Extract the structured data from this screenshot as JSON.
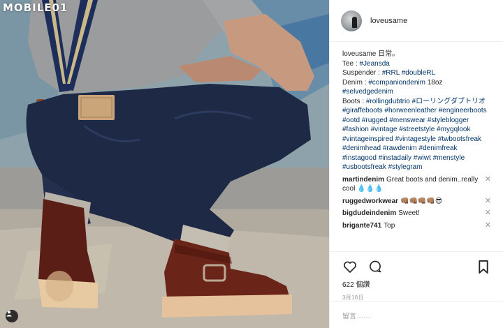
{
  "photo": {
    "watermark": "MOBILE01",
    "media_badge_icon": "person-tag-icon"
  },
  "header": {
    "username": "loveusame"
  },
  "caption": {
    "username": "loveusame",
    "lines": [
      {
        "text": "日常。",
        "tags": []
      },
      {
        "text": "Tee : ",
        "tags": [
          "#Jeansda"
        ]
      },
      {
        "text": "Suspender : ",
        "tags": [
          "#RRL",
          "#doubleRL"
        ]
      },
      {
        "text": "Denim : ",
        "tags": [
          "#companiondenim"
        ],
        "suffix": " 18oz"
      },
      {
        "text": "",
        "tags": [
          "#selvedgedenim"
        ]
      },
      {
        "text": "Boots : ",
        "tags": [
          "#rollingdubtrio",
          "#ローリングダブトリオ",
          "#giraffeboots",
          "#horweenleather",
          "#engineerboots"
        ]
      },
      {
        "text": "",
        "tags": [
          "#ootd",
          "#rugged",
          "#menswear",
          "#styleblogger",
          "#fashion",
          "#vintage",
          "#streetstyle",
          "#mygqlook",
          "#vintageinspired",
          "#vintagestyle",
          "#twbootsfreak",
          "#denimhead",
          "#rawdenim",
          "#denimfreak",
          "#instagood",
          "#instadaily",
          "#wiwt",
          "#menstyle",
          "#usbootsfreak",
          "#stylegram"
        ]
      }
    ]
  },
  "comments": [
    {
      "user": "martindenim",
      "text": "Great boots and denim..really cool 💧💧💧"
    },
    {
      "user": "ruggedworkwear",
      "text": "👊🏽👊🏽👊🏽👊🏽😎"
    },
    {
      "user": "bigdudeindenim",
      "text": "Sweet!"
    },
    {
      "user": "brigante741",
      "text": "Top"
    }
  ],
  "actions": {
    "likes": "622 個讚",
    "date": "3月18日"
  },
  "comment_input": {
    "placeholder": "留言……"
  }
}
